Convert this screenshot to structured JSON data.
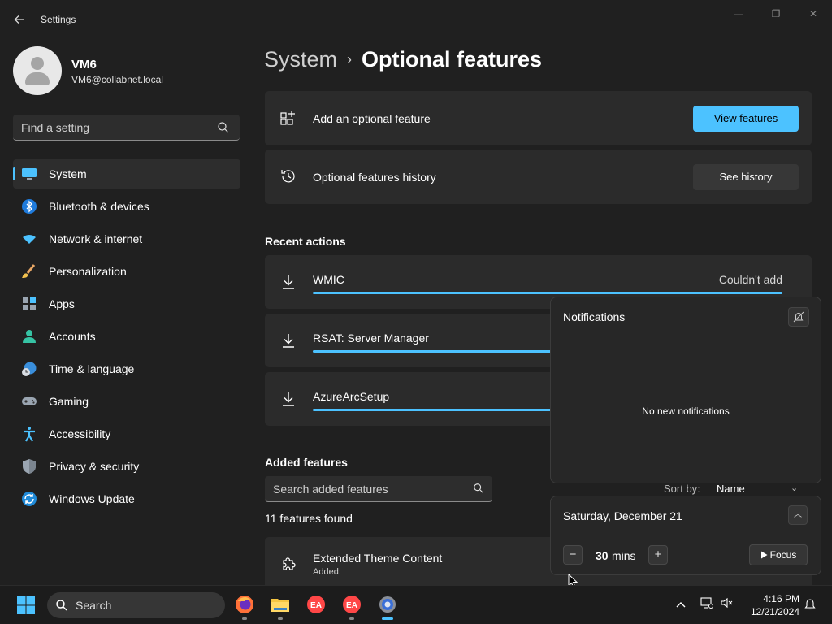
{
  "window": {
    "title": "Settings",
    "back_icon": "arrow-left-icon",
    "controls": {
      "minimize": "—",
      "restore": "❐",
      "close": "✕"
    }
  },
  "user": {
    "name": "VM6",
    "email": "VM6@collabnet.local"
  },
  "sidebar": {
    "search_placeholder": "Find a setting",
    "items": [
      {
        "label": "System",
        "icon": "monitor-icon"
      },
      {
        "label": "Bluetooth & devices",
        "icon": "bluetooth-icon"
      },
      {
        "label": "Network & internet",
        "icon": "wifi-icon"
      },
      {
        "label": "Personalization",
        "icon": "brush-icon"
      },
      {
        "label": "Apps",
        "icon": "apps-icon"
      },
      {
        "label": "Accounts",
        "icon": "person-icon"
      },
      {
        "label": "Time & language",
        "icon": "globe-clock-icon"
      },
      {
        "label": "Gaming",
        "icon": "gamepad-icon"
      },
      {
        "label": "Accessibility",
        "icon": "accessibility-icon"
      },
      {
        "label": "Privacy & security",
        "icon": "shield-icon"
      },
      {
        "label": "Windows Update",
        "icon": "update-icon"
      }
    ],
    "active_index": 0
  },
  "breadcrumb": {
    "parent": "System",
    "separator": "›",
    "current": "Optional features"
  },
  "cards": {
    "add": {
      "label": "Add an optional feature",
      "button": "View features"
    },
    "history": {
      "label": "Optional features history",
      "button": "See history"
    }
  },
  "recent_actions": {
    "heading": "Recent actions",
    "items": [
      {
        "name": "WMIC",
        "status": "Couldn't add",
        "progress": 1.0
      },
      {
        "name": "RSAT: Server Manager",
        "status": "",
        "progress": 1.0
      },
      {
        "name": "AzureArcSetup",
        "status": "",
        "progress": 1.0
      }
    ]
  },
  "added_features": {
    "heading": "Added features",
    "search_placeholder": "Search added features",
    "count_text": "11 features found",
    "sort_label": "Sort by:",
    "sort_value": "Name",
    "first_item": {
      "name": "Extended Theme Content",
      "sub": "Added:"
    }
  },
  "notifications": {
    "title": "Notifications",
    "empty_text": "No new notifications"
  },
  "calendar": {
    "date": "Saturday, December 21",
    "focus_minutes": "30",
    "focus_unit": "mins",
    "focus_button": "Focus"
  },
  "taskbar": {
    "search_text": "Search",
    "time": "4:16 PM",
    "date": "12/21/2024"
  },
  "colors": {
    "accent": "#4cc2ff",
    "background": "#202020",
    "card": "#2b2b2b"
  }
}
